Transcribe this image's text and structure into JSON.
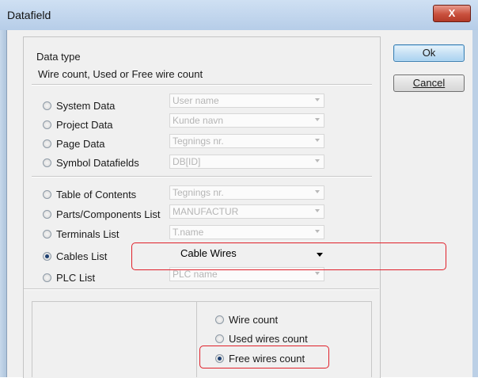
{
  "window": {
    "title": "Datafield",
    "close_glyph": "X"
  },
  "data_type": {
    "heading": "Data type",
    "current": "Wire count, Used or Free wire count"
  },
  "buttons": {
    "ok": "Ok",
    "cancel": "Cancel"
  },
  "sources": [
    {
      "label": "System Data",
      "combo": "User name",
      "checked": false
    },
    {
      "label": "Project Data",
      "combo": "Kunde navn",
      "checked": false
    },
    {
      "label": "Page Data",
      "combo": "Tegnings nr.",
      "checked": false
    },
    {
      "label": "Symbol Datafields",
      "combo": "DB[ID]",
      "checked": false
    },
    {
      "label": "Table of Contents",
      "combo": "Tegnings nr.",
      "checked": false
    },
    {
      "label": "Parts/Components List",
      "combo": "MANUFACTUR",
      "checked": false
    },
    {
      "label": "Terminals List",
      "combo": "T.name",
      "checked": false
    },
    {
      "label": "Cables List",
      "combo": "Cable Wires",
      "checked": true
    },
    {
      "label": "PLC List",
      "combo": "PLC name",
      "checked": false
    }
  ],
  "wire_options": [
    {
      "label": "Wire count",
      "checked": false
    },
    {
      "label": "Used wires count",
      "checked": false
    },
    {
      "label": "Free wires count",
      "checked": true
    }
  ],
  "colors": {
    "highlight": "#e0202a",
    "titlebar": "#b6cde8",
    "dialog_bg": "#f0f0f0"
  }
}
